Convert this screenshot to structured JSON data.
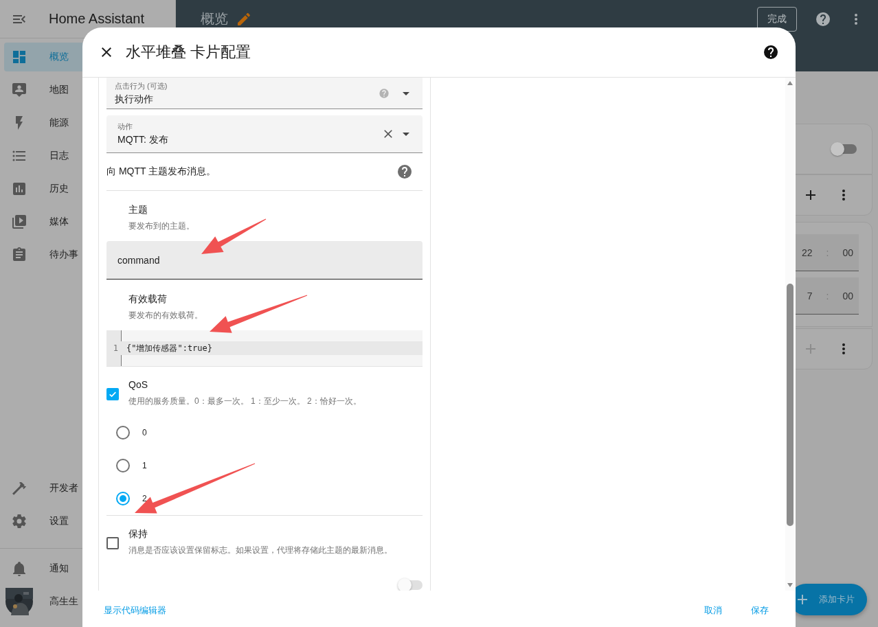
{
  "sidebar": {
    "title": "Home Assistant",
    "items": [
      {
        "label": "概览",
        "selected": true
      },
      {
        "label": "地图",
        "selected": false
      },
      {
        "label": "能源",
        "selected": false
      },
      {
        "label": "日志",
        "selected": false
      },
      {
        "label": "历史",
        "selected": false
      },
      {
        "label": "媒体",
        "selected": false
      },
      {
        "label": "待办事",
        "selected": false
      }
    ],
    "bottom_items": [
      {
        "label": "开发者",
        "selected": false
      },
      {
        "label": "设置",
        "selected": false
      }
    ],
    "notifications": {
      "label": "通知"
    },
    "user": {
      "name": "高生生"
    }
  },
  "toolbar": {
    "title": "概览",
    "done_button": "完成"
  },
  "cards": [
    {
      "kind": "switch",
      "on": false
    },
    {
      "kind": "actions",
      "disabled": false
    },
    {
      "kind": "times",
      "times": [
        {
          "hour": "22",
          "separator": ":",
          "minute": "00"
        },
        {
          "hour": "7",
          "separator": ":",
          "minute": "00"
        }
      ]
    },
    {
      "kind": "actions",
      "disabled": true
    }
  ],
  "fab": {
    "label": "添加卡片"
  },
  "dialog": {
    "title": "水平堆叠 卡片配置",
    "tap_action": {
      "label": "点击行为 (可选)",
      "value": "执行动作"
    },
    "action": {
      "label": "动作",
      "value": "MQTT: 发布"
    },
    "description": "向 MQTT 主题发布消息。",
    "fields": [
      {
        "kind": "text",
        "name": "主题",
        "description": "要发布到的主题。",
        "value": "command"
      },
      {
        "kind": "code",
        "name": "有效载荷",
        "description": "要发布的有效载荷。",
        "line_number": "1",
        "code": "{\"增加传感器\":true}"
      },
      {
        "kind": "radio",
        "name": "QoS",
        "description": "使用的服务质量。0：最多一次。 1：至少一次。 2：恰好一次。",
        "checked": true,
        "options": [
          {
            "label": "0",
            "selected": false
          },
          {
            "label": "1",
            "selected": false
          },
          {
            "label": "2",
            "selected": true
          }
        ]
      },
      {
        "kind": "checkbox",
        "name": "保持",
        "description": "消息是否应该设置保留标志。如果设置，代理将存储此主题的最新消息。",
        "checked": false
      }
    ],
    "switch": {
      "on": false
    },
    "footer": {
      "code_editor_button": "显示代码编辑器",
      "cancel_button": "取消",
      "save_button": "保存"
    }
  }
}
